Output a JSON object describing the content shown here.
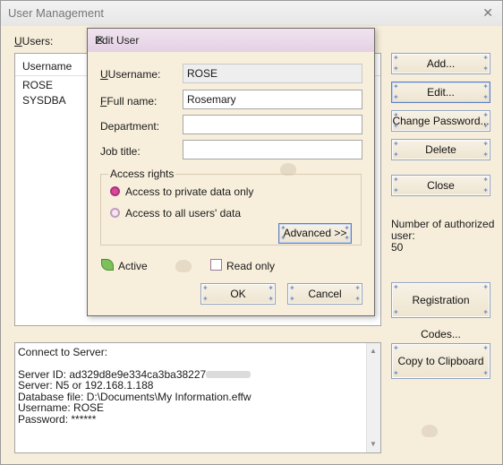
{
  "window": {
    "title": "User Management",
    "close_glyph": "✕"
  },
  "users_label": "Users:",
  "users_list": {
    "header": "Username",
    "rows": [
      "ROSE",
      "SYSDBA"
    ]
  },
  "buttons": {
    "add": "Add...",
    "edit": "Edit...",
    "change_password": "Change Password...",
    "delete": "Delete",
    "close": "Close",
    "registration_codes": "Registration Codes...",
    "copy_clipboard": "Copy to Clipboard"
  },
  "authorized": {
    "line1": "Number of authorized",
    "line2": "user:",
    "count": "50"
  },
  "info_text": {
    "line1": "Connect to Server:",
    "server_id_prefix": "Server ID: ",
    "server_id": "ad329d8e9e334ca3ba38227",
    "server": "Server: N5 or 192.168.1.188",
    "database": "Database file: D:\\Documents\\My Information.effw",
    "username": "Username: ROSE",
    "password": "Password: ******"
  },
  "dialog": {
    "title": "Edit User",
    "close_glyph": "✕",
    "username_label": "Username:",
    "username_value": "ROSE",
    "fullname_label": "Full name:",
    "fullname_value": "Rosemary",
    "department_label": "Department:",
    "department_value": "",
    "jobtitle_label": "Job title:",
    "jobtitle_value": "",
    "access_rights_label": "Access rights",
    "access_private": "Access to private data only",
    "access_all": "Access to all users' data",
    "advanced": "Advanced >>",
    "active_label": "Active",
    "readonly_label": "Read only",
    "ok": "OK",
    "cancel": "Cancel"
  },
  "colors": {
    "accent": "#5d7fbf",
    "title_tint": "#e4d1e4",
    "radio_selected": "#d8489a"
  }
}
